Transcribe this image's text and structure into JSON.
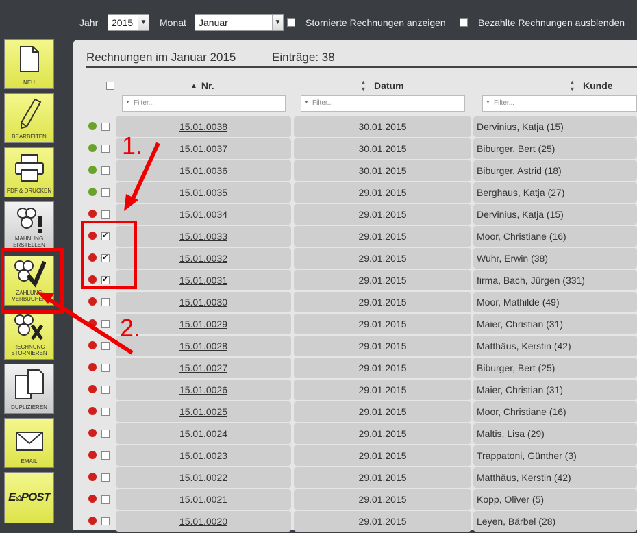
{
  "topbar": {
    "year_label": "Jahr",
    "year_value": "2015",
    "month_label": "Monat",
    "month_value": "Januar",
    "cancelled_label": "Stornierte Rechnungen anzeigen",
    "paid_label": "Bezahlte Rechnungen ausblenden"
  },
  "sidebar": [
    {
      "label": "NEU",
      "icon": "document-icon"
    },
    {
      "label": "BEARBEITEN",
      "icon": "pencil-icon"
    },
    {
      "label": "PDF & DRUCKEN",
      "icon": "printer-icon"
    },
    {
      "label": "MAHNUNG ERSTELLEN",
      "icon": "coins-exclamation-icon"
    },
    {
      "label": "ZAHLUNG VERBUCHEN",
      "icon": "coins-check-icon"
    },
    {
      "label": "RECHNUNG STORNIEREN",
      "icon": "coins-x-icon"
    },
    {
      "label": "DUPLIZIEREN",
      "icon": "duplicate-icon"
    },
    {
      "label": "EMAIL",
      "icon": "envelope-icon"
    },
    {
      "label": "E-POST",
      "icon": "epost-logo"
    }
  ],
  "panel": {
    "title": "Rechnungen im Januar 2015",
    "count": "Einträge: 38",
    "columns": [
      {
        "label": "Nr.",
        "sort": "▲"
      },
      {
        "label": "Datum",
        "sort": "▲▼"
      },
      {
        "label": "Kunde",
        "sort": "▲▼"
      }
    ],
    "filter_placeholder": "Filter..."
  },
  "rows": [
    {
      "status": "green",
      "checked": false,
      "nr": "15.01.0038",
      "datum": "30.01.2015",
      "kunde": "Dervinius, Katja (15)"
    },
    {
      "status": "green",
      "checked": false,
      "nr": "15.01.0037",
      "datum": "30.01.2015",
      "kunde": "Biburger, Bert (25)"
    },
    {
      "status": "green",
      "checked": false,
      "nr": "15.01.0036",
      "datum": "30.01.2015",
      "kunde": "Biburger, Astrid (18)"
    },
    {
      "status": "green",
      "checked": false,
      "nr": "15.01.0035",
      "datum": "29.01.2015",
      "kunde": "Berghaus, Katja (27)"
    },
    {
      "status": "red",
      "checked": false,
      "nr": "15.01.0034",
      "datum": "29.01.2015",
      "kunde": "Dervinius, Katja (15)"
    },
    {
      "status": "red",
      "checked": true,
      "nr": "15.01.0033",
      "datum": "29.01.2015",
      "kunde": "Moor, Christiane (16)"
    },
    {
      "status": "red",
      "checked": true,
      "nr": "15.01.0032",
      "datum": "29.01.2015",
      "kunde": "Wuhr, Erwin (38)"
    },
    {
      "status": "red",
      "checked": true,
      "nr": "15.01.0031",
      "datum": "29.01.2015",
      "kunde": "firma, Bach, Jürgen (331)"
    },
    {
      "status": "red",
      "checked": false,
      "nr": "15.01.0030",
      "datum": "29.01.2015",
      "kunde": "Moor, Mathilde (49)"
    },
    {
      "status": "red",
      "checked": false,
      "nr": "15.01.0029",
      "datum": "29.01.2015",
      "kunde": "Maier, Christian (31)"
    },
    {
      "status": "red",
      "checked": false,
      "nr": "15.01.0028",
      "datum": "29.01.2015",
      "kunde": "Matthäus, Kerstin (42)"
    },
    {
      "status": "red",
      "checked": false,
      "nr": "15.01.0027",
      "datum": "29.01.2015",
      "kunde": "Biburger, Bert (25)"
    },
    {
      "status": "red",
      "checked": false,
      "nr": "15.01.0026",
      "datum": "29.01.2015",
      "kunde": "Maier, Christian (31)"
    },
    {
      "status": "red",
      "checked": false,
      "nr": "15.01.0025",
      "datum": "29.01.2015",
      "kunde": "Moor, Christiane (16)"
    },
    {
      "status": "red",
      "checked": false,
      "nr": "15.01.0024",
      "datum": "29.01.2015",
      "kunde": "Maltis, Lisa (29)"
    },
    {
      "status": "red",
      "checked": false,
      "nr": "15.01.0023",
      "datum": "29.01.2015",
      "kunde": "Trappatoni, Günther (3)"
    },
    {
      "status": "red",
      "checked": false,
      "nr": "15.01.0022",
      "datum": "29.01.2015",
      "kunde": "Matthäus, Kerstin (42)"
    },
    {
      "status": "red",
      "checked": false,
      "nr": "15.01.0021",
      "datum": "29.01.2015",
      "kunde": "Kopp, Oliver (5)"
    },
    {
      "status": "red",
      "checked": false,
      "nr": "15.01.0020",
      "datum": "29.01.2015",
      "kunde": "Leyen, Bärbel (28)"
    }
  ],
  "annotations": {
    "step1": "1.",
    "step2": "2.",
    "color": "#e00000"
  }
}
